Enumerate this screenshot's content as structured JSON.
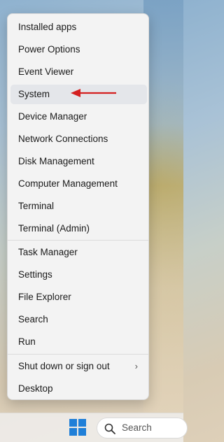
{
  "menu": {
    "items": [
      {
        "label": "Installed apps"
      },
      {
        "label": "Power Options"
      },
      {
        "label": "Event Viewer"
      },
      {
        "label": "System"
      },
      {
        "label": "Device Manager"
      },
      {
        "label": "Network Connections"
      },
      {
        "label": "Disk Management"
      },
      {
        "label": "Computer Management"
      },
      {
        "label": "Terminal"
      },
      {
        "label": "Terminal (Admin)"
      },
      {
        "label": "Task Manager"
      },
      {
        "label": "Settings"
      },
      {
        "label": "File Explorer"
      },
      {
        "label": "Search"
      },
      {
        "label": "Run"
      },
      {
        "label": "Shut down or sign out",
        "submenu_indicator": "›"
      },
      {
        "label": "Desktop"
      }
    ],
    "highlighted_item": "System"
  },
  "annotation": {
    "arrow_color": "#d42020"
  },
  "taskbar": {
    "start_icon": "windows-logo-icon",
    "start_color": "#1f7fd8",
    "search": {
      "label": "Search"
    }
  }
}
